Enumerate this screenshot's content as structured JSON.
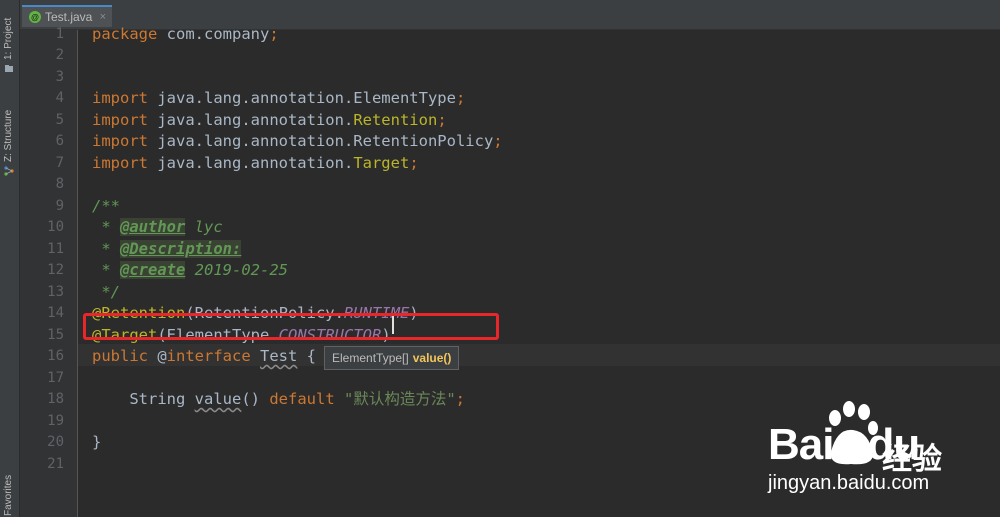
{
  "toolstrip": {
    "project_label": "1: Project",
    "structure_label": "Z: Structure",
    "bottom_label": "Favorites"
  },
  "tab": {
    "title": "Test.java",
    "icon": "@",
    "close": "×"
  },
  "lines": [
    {
      "n": "1",
      "tokens": [
        {
          "t": "package",
          "c": "kw"
        },
        {
          "t": " com.company",
          "c": ""
        },
        {
          "t": ";",
          "c": "kw"
        }
      ]
    },
    {
      "n": "2",
      "tokens": []
    },
    {
      "n": "3",
      "tokens": []
    },
    {
      "n": "4",
      "tokens": [
        {
          "t": "import",
          "c": "kw"
        },
        {
          "t": " java.lang.annotation.ElementType",
          "c": ""
        },
        {
          "t": ";",
          "c": "kw"
        }
      ]
    },
    {
      "n": "5",
      "tokens": [
        {
          "t": "import",
          "c": "kw"
        },
        {
          "t": " java.lang.annotation.",
          "c": ""
        },
        {
          "t": "Retention",
          "c": "ann"
        },
        {
          "t": ";",
          "c": "kw"
        }
      ]
    },
    {
      "n": "6",
      "tokens": [
        {
          "t": "import",
          "c": "kw"
        },
        {
          "t": " java.lang.annotation.RetentionPolicy",
          "c": ""
        },
        {
          "t": ";",
          "c": "kw"
        }
      ]
    },
    {
      "n": "7",
      "tokens": [
        {
          "t": "import",
          "c": "kw"
        },
        {
          "t": " java.lang.annotation.",
          "c": ""
        },
        {
          "t": "Target",
          "c": "ann"
        },
        {
          "t": ";",
          "c": "kw"
        }
      ]
    },
    {
      "n": "8",
      "tokens": []
    },
    {
      "n": "9",
      "tokens": [
        {
          "t": "/**",
          "c": "cmt"
        }
      ]
    },
    {
      "n": "10",
      "tokens": [
        {
          "t": " * ",
          "c": "cmt"
        },
        {
          "t": "@author",
          "c": "tag"
        },
        {
          "t": " lyc",
          "c": "cmt"
        }
      ]
    },
    {
      "n": "11",
      "tokens": [
        {
          "t": " * ",
          "c": "cmt"
        },
        {
          "t": "@Description:",
          "c": "tag"
        }
      ]
    },
    {
      "n": "12",
      "tokens": [
        {
          "t": " * ",
          "c": "cmt"
        },
        {
          "t": "@create",
          "c": "tag"
        },
        {
          "t": " 2019-02-25",
          "c": "cmt"
        }
      ]
    },
    {
      "n": "13",
      "tokens": [
        {
          "t": " */",
          "c": "cmt"
        }
      ]
    },
    {
      "n": "14",
      "tokens": [
        {
          "t": "@Retention",
          "c": "ann"
        },
        {
          "t": "(RetentionPolicy.",
          "c": ""
        },
        {
          "t": "RUNTIME",
          "c": "const"
        },
        {
          "t": ")",
          "c": ""
        }
      ]
    },
    {
      "n": "15",
      "tokens": [
        {
          "t": "@Target",
          "c": "ann"
        },
        {
          "t": "(ElementType.",
          "c": ""
        },
        {
          "t": "CONSTRUCTOR",
          "c": "const"
        },
        {
          "t": ")",
          "c": ""
        }
      ]
    },
    {
      "n": "16",
      "tokens": [
        {
          "t": "public",
          "c": "kw"
        },
        {
          "t": " @",
          "c": ""
        },
        {
          "t": "interface",
          "c": "kw"
        },
        {
          "t": " ",
          "c": ""
        },
        {
          "t": "Test",
          "c": "squig"
        },
        {
          "t": " {",
          "c": ""
        }
      ]
    },
    {
      "n": "17",
      "tokens": []
    },
    {
      "n": "18",
      "tokens": [
        {
          "t": "    String ",
          "c": ""
        },
        {
          "t": "value",
          "c": "squig"
        },
        {
          "t": "() ",
          "c": ""
        },
        {
          "t": "default",
          "c": "kw"
        },
        {
          "t": " ",
          "c": ""
        },
        {
          "t": "\"默认构造方法\"",
          "c": "str"
        },
        {
          "t": ";",
          "c": "kw"
        }
      ]
    },
    {
      "n": "19",
      "tokens": []
    },
    {
      "n": "20",
      "tokens": [
        {
          "t": "}",
          "c": ""
        }
      ]
    },
    {
      "n": "21",
      "tokens": []
    }
  ],
  "tooltip": {
    "type": "ElementType[]",
    "method": "value()"
  },
  "watermark": {
    "logo": "Bai",
    "logo2": "du",
    "cn": "经验",
    "url": "jingyan.baidu.com"
  },
  "colors": {
    "editor_bg": "#2B2B2B",
    "gutter_bg": "#313335",
    "highlight": "#E8272B",
    "keyword": "#CC7832",
    "annotation": "#BBB529",
    "comment": "#629755"
  }
}
